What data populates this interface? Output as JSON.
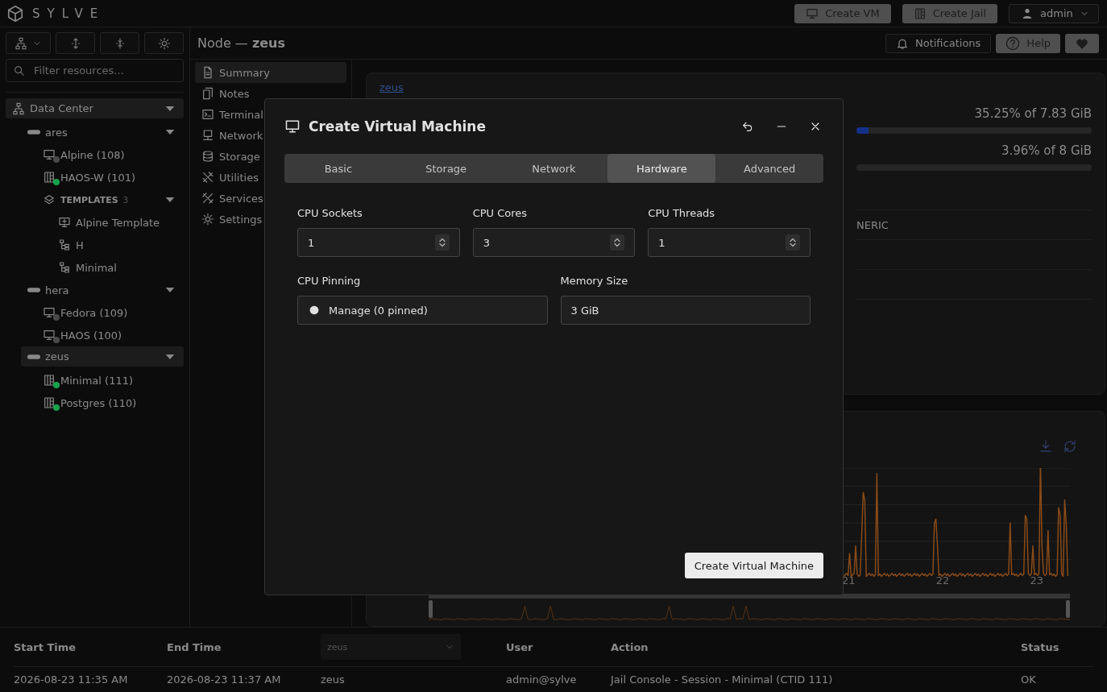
{
  "app": {
    "logo": "SYLVE"
  },
  "header_buttons": [
    {
      "label": "Create VM",
      "kind": "monitor"
    },
    {
      "label": "Create Jail",
      "kind": "jail"
    }
  ],
  "user_menu": {
    "label": "admin"
  },
  "filter": {
    "placeholder": "Filter resources..."
  },
  "tree": [
    {
      "label": "Data Center",
      "kind": "datacenter",
      "selected": true,
      "expanded": true,
      "children": [
        {
          "label": "ares",
          "kind": "node",
          "selected": false,
          "expanded": true,
          "children": [
            {
              "label": "Alpine (108)",
              "kind": "vm",
              "selected": false,
              "color": "#4a4a4a"
            },
            {
              "label": "HAOS-W (101)",
              "kind": "jail",
              "selected": false,
              "color": "#16a34a"
            },
            {
              "label": "TEMPLATES",
              "count": "3",
              "kind": "group",
              "selected": false,
              "expanded": true,
              "children": [
                {
                  "label": "Alpine Template",
                  "kind": "template-vm",
                  "selected": false
                },
                {
                  "label": "H",
                  "kind": "template-jail",
                  "selected": false
                },
                {
                  "label": "Minimal",
                  "kind": "template-jail",
                  "selected": false
                }
              ]
            }
          ]
        },
        {
          "label": "hera",
          "kind": "node",
          "selected": false,
          "expanded": true,
          "children": [
            {
              "label": "Fedora (109)",
              "kind": "vm",
              "selected": false,
              "color": "#4a4a4a"
            },
            {
              "label": "HAOS (100)",
              "kind": "vm",
              "selected": false,
              "color": "#4a4a4a"
            }
          ]
        },
        {
          "label": "zeus",
          "kind": "node",
          "selected": true,
          "expanded": true,
          "children": [
            {
              "label": "Minimal (111)",
              "kind": "jail",
              "selected": false,
              "color": "#16a34a"
            },
            {
              "label": "Postgres (110)",
              "kind": "jail",
              "selected": false,
              "color": "#16a34a"
            }
          ]
        }
      ]
    }
  ],
  "page_title": "Node — **zeus**",
  "top_actions": [
    {
      "label": "Notifications",
      "kind": "bell"
    },
    {
      "label": "Help",
      "kind": "help"
    },
    {
      "kind": "heart"
    }
  ],
  "nav": [
    {
      "label": "Summary",
      "kind": "file",
      "selected": true
    },
    {
      "label": "Notes",
      "kind": "notes",
      "selected": false
    },
    {
      "label": "Terminal",
      "kind": "terminal",
      "selected": false
    },
    {
      "label": "Network",
      "kind": "network",
      "selected": false
    },
    {
      "label": "Storage",
      "kind": "storage",
      "selected": false
    },
    {
      "label": "Utilities",
      "kind": "tools",
      "selected": false
    },
    {
      "label": "Services",
      "kind": "services",
      "selected": false
    },
    {
      "label": "Settings",
      "kind": "gear",
      "selected": false
    }
  ],
  "summary": {
    "node_link": "zeus",
    "meters": [
      {
        "reading": "35.25% of 7.83 GiB",
        "level": 0.05
      },
      {
        "reading": "3.96% of 8 GiB",
        "level": 0
      }
    ],
    "info_fragment": "NERIC"
  },
  "chart": {
    "x_labels": [
      "21",
      "22",
      "23"
    ],
    "range": {
      "level": 1
    }
  },
  "dialog": {
    "title": "Create Virtual Machine",
    "tabs": [
      {
        "label": "Basic",
        "selected": false
      },
      {
        "label": "Storage",
        "selected": false
      },
      {
        "label": "Network",
        "selected": false
      },
      {
        "label": "Hardware",
        "selected": true
      },
      {
        "label": "Advanced",
        "selected": false
      }
    ],
    "fields": [
      {
        "label": "CPU Sockets",
        "kind": "number",
        "value": "1"
      },
      {
        "label": "CPU Cores",
        "kind": "number",
        "value": "3"
      },
      {
        "label": "CPU Threads",
        "kind": "number",
        "value": "1"
      },
      {
        "label": "CPU Pinning",
        "kind": "button",
        "value": "Manage (0 pinned)"
      },
      {
        "label": "Memory Size",
        "kind": "text",
        "value": "3 GiB"
      }
    ],
    "submit": "Create Virtual Machine"
  },
  "log_table": {
    "columns": [
      {
        "kind": "text",
        "label": "Start Time"
      },
      {
        "kind": "text",
        "label": "End Time"
      },
      {
        "kind": "select",
        "value": "zeus"
      },
      {
        "kind": "text",
        "label": "User"
      },
      {
        "kind": "text",
        "label": "Action"
      },
      {
        "kind": "text",
        "label": "Status"
      }
    ],
    "rows": [
      [
        "2026-08-23 11:35 AM",
        "2026-08-23 11:37 AM",
        "zeus",
        "admin@sylve",
        "Jail Console - Session - Minimal (CTID 111)",
        "OK"
      ]
    ]
  }
}
